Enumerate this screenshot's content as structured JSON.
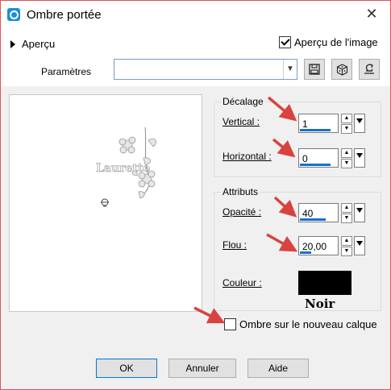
{
  "window": {
    "title": "Ombre portée"
  },
  "top": {
    "preview_toggle_label": "Aperçu",
    "image_preview_label": "Aperçu de l'image",
    "image_preview_checked": true,
    "params_label": "Paramètres",
    "preset_value": ""
  },
  "preview": {
    "watermark_text": "Laurette"
  },
  "offset": {
    "group_title": "Décalage",
    "vertical_label": "Vertical :",
    "vertical_value": "1",
    "horizontal_label": "Horizontal :",
    "horizontal_value": "0"
  },
  "attributes": {
    "group_title": "Attributs",
    "opacity_label": "Opacité :",
    "opacity_value": "40",
    "blur_label": "Flou :",
    "blur_value": "20,00",
    "color_label": "Couleur :",
    "color_value": "#000000",
    "color_annotation": "Noir"
  },
  "options": {
    "new_layer_label": "Ombre sur le nouveau calque",
    "new_layer_checked": false
  },
  "buttons": {
    "ok": "OK",
    "cancel": "Annuler",
    "help": "Aide"
  },
  "colors": {
    "accent": "#1a6fd0",
    "annotation_arrows": "#d9433f",
    "window_border": "#e0525e"
  },
  "icons": [
    "app-icon",
    "close-icon",
    "expand-triangle-icon",
    "chevron-down-icon",
    "save-icon",
    "dice-icon",
    "reset-icon",
    "spin-up-icon",
    "spin-down-icon",
    "slider-dropdown-icon"
  ]
}
